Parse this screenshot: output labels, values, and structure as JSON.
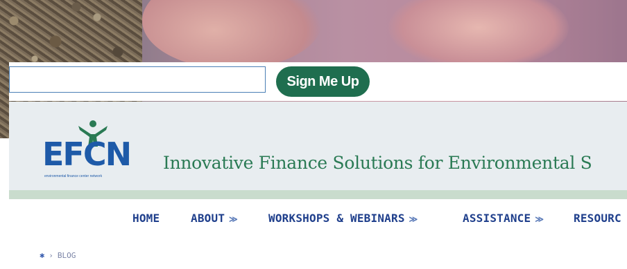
{
  "signup": {
    "input_value": "",
    "button_label": "Sign Me Up"
  },
  "header": {
    "logo_text": "EFCN",
    "logo_subtext": "environmental finance center network",
    "tagline": "Innovative Finance Solutions for Environmental S"
  },
  "nav": {
    "items": [
      {
        "label": "HOME",
        "dropdown": false
      },
      {
        "label": "ABOUT",
        "dropdown": true
      },
      {
        "label": "WORKSHOPS & WEBINARS",
        "dropdown": true
      },
      {
        "label": "ASSISTANCE",
        "dropdown": true
      },
      {
        "label": "RESOURC",
        "dropdown": false
      }
    ],
    "dropdown_glyph": "≫"
  },
  "breadcrumb": {
    "home_icon": "home-icon",
    "separator": "›",
    "current": "BLOG"
  },
  "colors": {
    "brand_blue": "#1e5aa8",
    "brand_green": "#1f6e4f",
    "tagline_green": "#2a7a54",
    "nav_blue": "#1f3f8c",
    "header_bg": "#e8edf0",
    "header_rule": "#c9dccd"
  }
}
